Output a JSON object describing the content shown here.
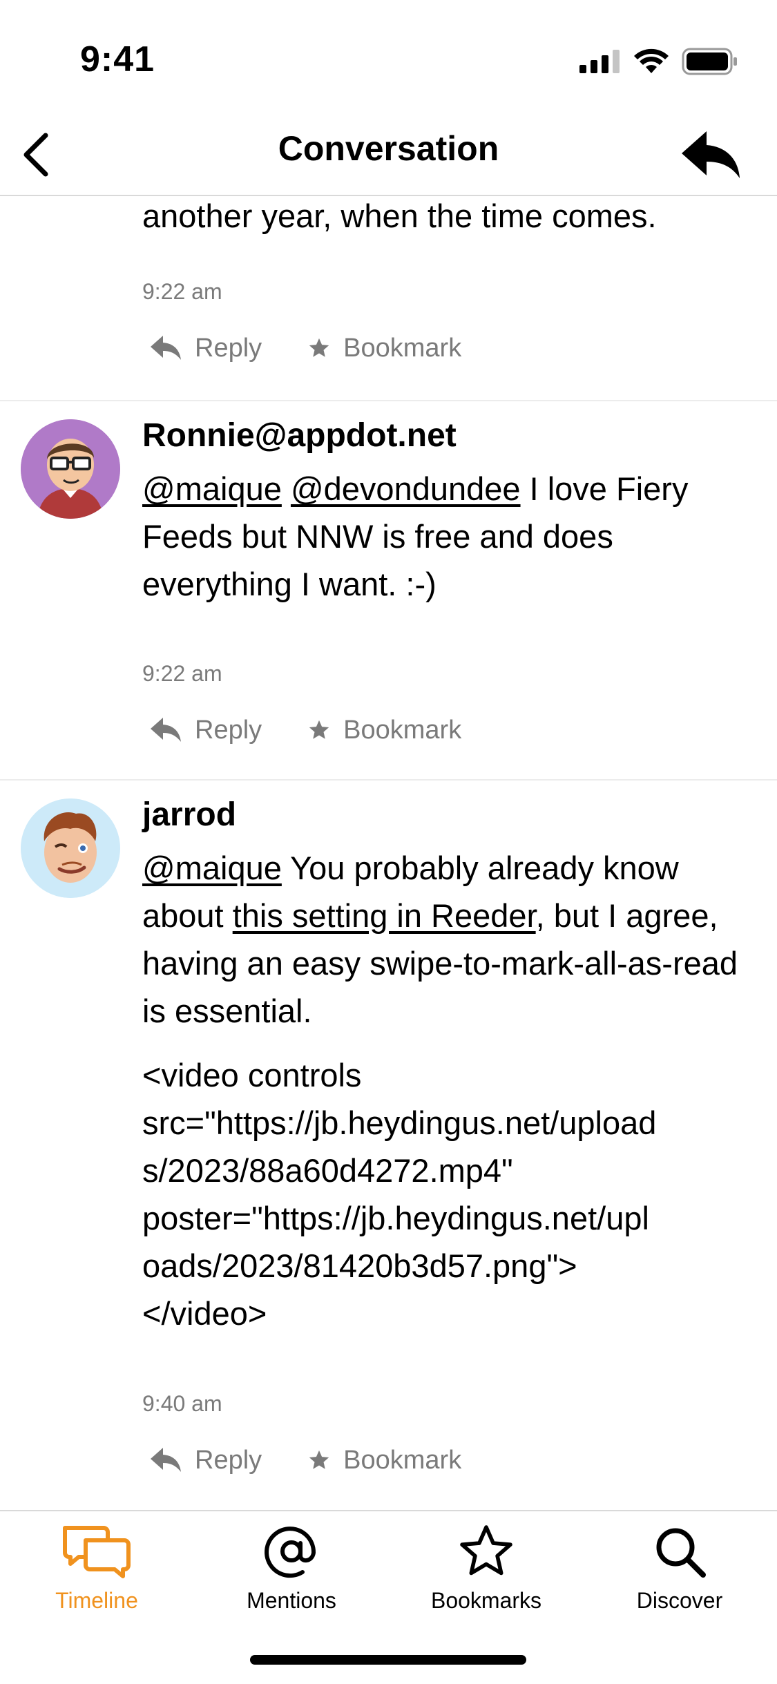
{
  "status_bar": {
    "time": "9:41"
  },
  "nav": {
    "title": "Conversation"
  },
  "posts": [
    {
      "text": "another year, when the time comes.",
      "time": "9:22 am",
      "reply_label": "Reply",
      "bookmark_label": "Bookmark"
    },
    {
      "username": "Ronnie@appdot.net",
      "mention1": "@maique",
      "mention2": "@devondundee",
      "text_rest": " I love Fiery Feeds but NNW is free and does everything I want. :-)",
      "time": "9:22 am",
      "reply_label": "Reply",
      "bookmark_label": "Bookmark"
    },
    {
      "username": "jarrod",
      "mention": "@maique",
      "text_a": " You probably already know about ",
      "link": "this setting in Reeder",
      "text_b": ", but I agree, having an easy swipe-to-mark-all-as-read is essential.",
      "code_lines": [
        "<video controls",
        "src=\"https://jb.heydingus.net/upload",
        "s/2023/88a60d4272.mp4\"",
        "poster=\"https://jb.heydingus.net/upl",
        "oads/2023/81420b3d57.png\">",
        "</video>"
      ],
      "time": "9:40 am",
      "reply_label": "Reply",
      "bookmark_label": "Bookmark"
    }
  ],
  "tabs": [
    {
      "label": "Timeline",
      "icon": "timeline-icon",
      "active": true
    },
    {
      "label": "Mentions",
      "icon": "at-icon"
    },
    {
      "label": "Bookmarks",
      "icon": "star-icon"
    },
    {
      "label": "Discover",
      "icon": "search-icon"
    }
  ],
  "colors": {
    "accent": "#f0921e",
    "muted": "#7a7a7a"
  }
}
